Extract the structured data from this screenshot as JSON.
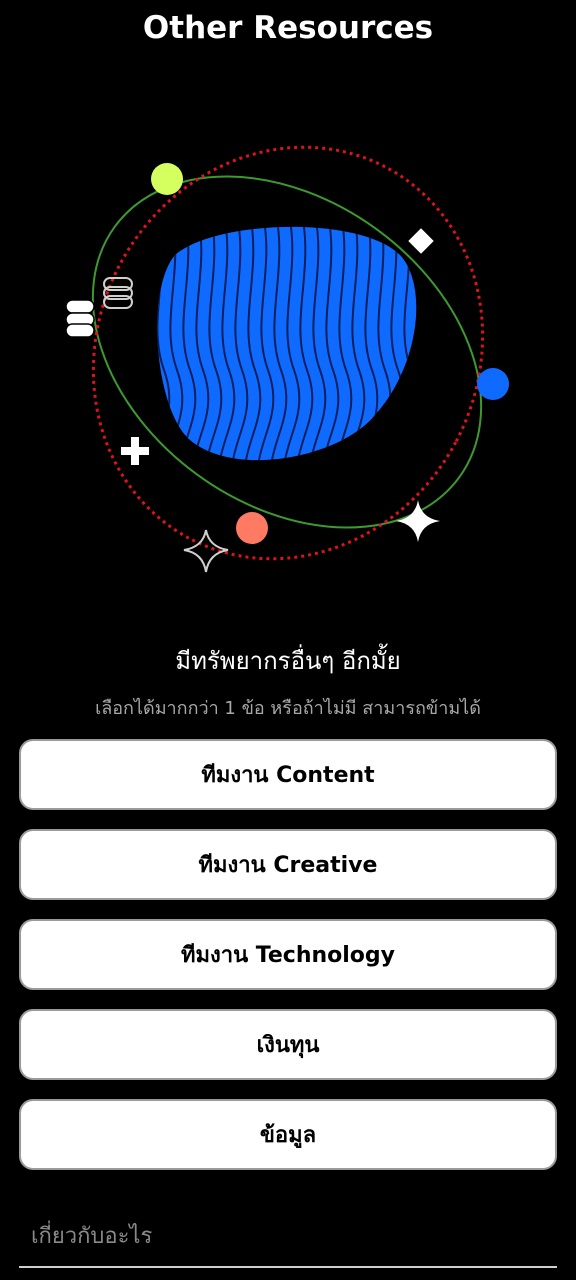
{
  "header": {
    "title": "Other Resources"
  },
  "illustration": {
    "colors": {
      "planet": "#0f6bff",
      "planet_stripes": "#0a1f5c",
      "orbit_green": "#3c9a2e",
      "orbit_red": "#e0121b",
      "lime_dot": "#d4ff5e",
      "blue_dot": "#0f6bff",
      "coral_dot": "#ff7a63",
      "white_shapes": "#ffffff"
    },
    "icons": [
      "planet-icon",
      "lime-dot-icon",
      "diamond-icon",
      "blue-dot-icon",
      "stack-outline-icon",
      "stack-filled-icon",
      "plus-icon",
      "coral-dot-icon",
      "sparkle-filled-icon",
      "sparkle-outline-icon"
    ]
  },
  "question": {
    "title": "มีทรัพยากรอื่นๆ อีกมั้ย",
    "hint": "เลือกได้มากกว่า 1 ข้อ หรือถ้าไม่มี สามารถข้ามได้"
  },
  "options": [
    {
      "label": "ทีมงาน Content"
    },
    {
      "label": "ทีมงาน Creative"
    },
    {
      "label": "ทีมงาน Technology"
    },
    {
      "label": "เงินทุน"
    },
    {
      "label": "ข้อมูล"
    }
  ],
  "topic_input": {
    "placeholder": "เกี่ยวกับอะไร",
    "value": ""
  }
}
